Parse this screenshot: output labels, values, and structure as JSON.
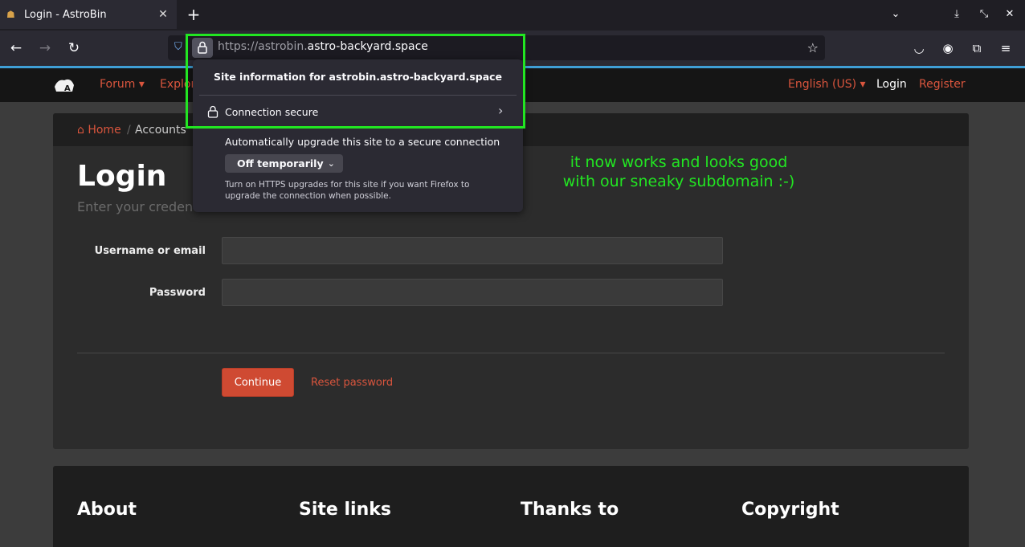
{
  "browser": {
    "tab_title": "Login - AstroBin",
    "url_scheme_prefix": "https://astrobin.",
    "url_host": "astro-backyard.space"
  },
  "site_nav": {
    "forum": "Forum ▾",
    "explore": "Explore",
    "language": "English (US) ▾",
    "login": "Login",
    "register": "Register"
  },
  "breadcrumb": {
    "home": "Home",
    "separator": "/",
    "accounts": "Accounts"
  },
  "login": {
    "title": "Login",
    "subtitle": "Enter your credentials",
    "username_label": "Username or email",
    "password_label": "Password",
    "continue_label": "Continue",
    "reset_label": "Reset password"
  },
  "footer": {
    "about": "About",
    "site_links": "Site links",
    "thanks": "Thanks to",
    "copyright": "Copyright"
  },
  "site_info_popup": {
    "title": "Site information for astrobin.astro-backyard.space",
    "connection": "Connection secure",
    "upgrade_label": "Automatically upgrade this site to a secure connection",
    "upgrade_value": "Off temporarily",
    "help_text": "Turn on HTTPS upgrades for this site if you want Firefox to upgrade the connection when possible."
  },
  "annotation": {
    "line1": "it now works and looks good",
    "line2": "with our sneaky subdomain :-)"
  },
  "colors": {
    "accent": "#d9553d",
    "highlight": "#22e622"
  }
}
